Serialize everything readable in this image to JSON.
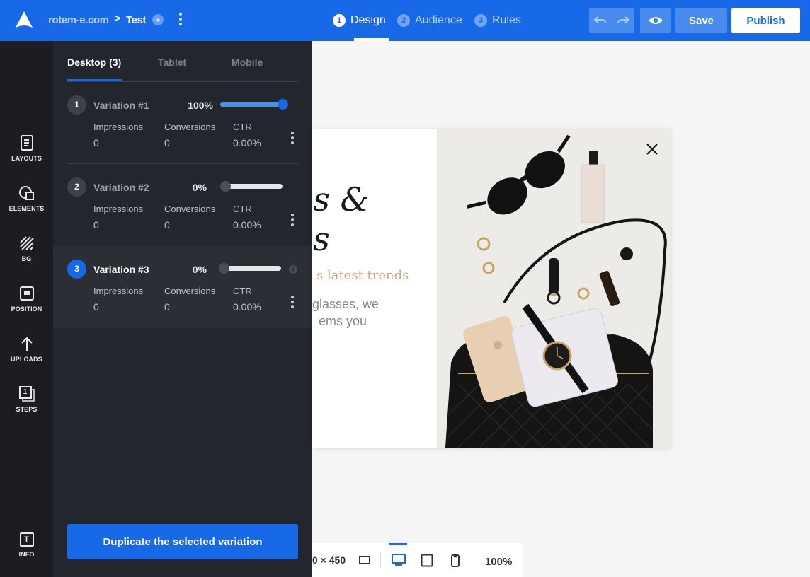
{
  "header": {
    "site": "rotem-e.com",
    "separator": ">",
    "project": "Test",
    "add_symbol": "+",
    "steps": [
      {
        "num": "1",
        "label": "Design"
      },
      {
        "num": "2",
        "label": "Audience"
      },
      {
        "num": "3",
        "label": "Rules"
      }
    ],
    "save_label": "Save",
    "publish_label": "Publish",
    "accent_color": "#1769e8"
  },
  "rail": {
    "items": [
      {
        "label": "LAYOUTS",
        "icon": "layouts-icon"
      },
      {
        "label": "ELEMENTS",
        "icon": "elements-icon"
      },
      {
        "label": "BG",
        "icon": "bg-icon"
      },
      {
        "label": "POSITION",
        "icon": "position-icon"
      },
      {
        "label": "UPLOADS",
        "icon": "upload-arrow-icon"
      },
      {
        "label": "STEPS",
        "icon": "steps-icon"
      }
    ],
    "steps_badge": "1",
    "info_label": "INFO",
    "info_glyph": "T"
  },
  "panel": {
    "tabs": [
      "Desktop (3)",
      "Tablet",
      "Mobile"
    ],
    "stat_headers": [
      "Impressions",
      "Conversions",
      "CTR"
    ],
    "variations": [
      {
        "num": "1",
        "name": "Variation #1",
        "percent": "100%",
        "split": 1.0,
        "impressions": "0",
        "conversions": "0",
        "ctr": "0.00%"
      },
      {
        "num": "2",
        "name": "Variation #2",
        "percent": "0%",
        "split": 0.0,
        "impressions": "0",
        "conversions": "0",
        "ctr": "0.00%"
      },
      {
        "num": "3",
        "name": "Variation #3",
        "percent": "0%",
        "split": 0.0,
        "impressions": "0",
        "conversions": "0",
        "ctr": "0.00%"
      }
    ],
    "info_symbol": "i",
    "duplicate_label": "Duplicate the selected variation"
  },
  "canvas": {
    "headline_line1": "es &",
    "headline_line2": "es",
    "subtitle": "s latest trends",
    "body_line1": "glasses, we",
    "body_line2": "ems you",
    "dimensions": "0 × 450",
    "zoom": "100%"
  }
}
